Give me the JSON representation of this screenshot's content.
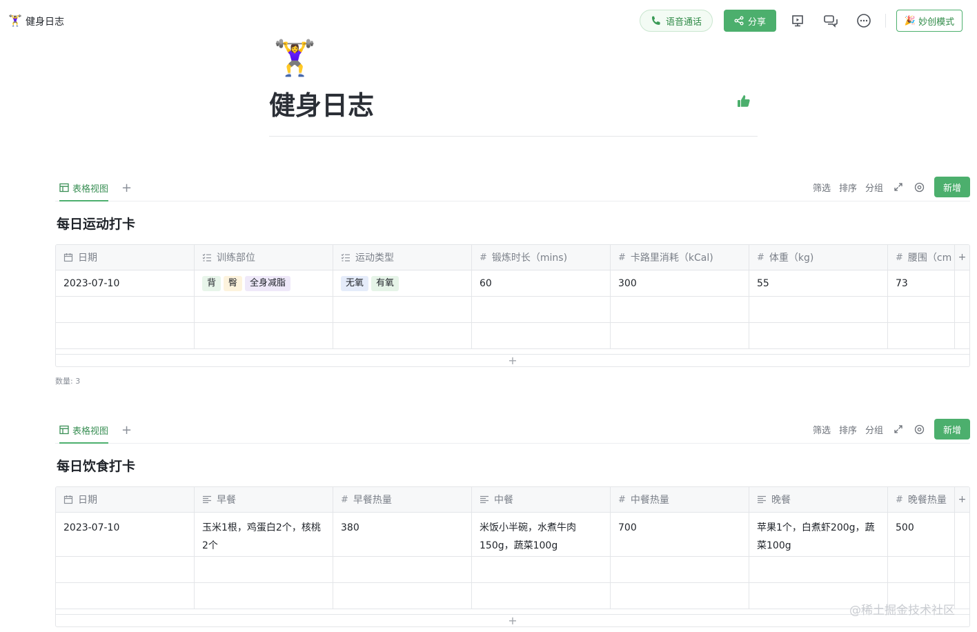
{
  "app": {
    "title": "健身日志",
    "icon": "weightlifting-emoji",
    "emoji": "🏋️‍♀️"
  },
  "toolbar": {
    "voice_call": "语音通话",
    "share": "分享",
    "magic_mode": "妙创模式",
    "icons": [
      "present-icon",
      "comment-icon",
      "more-icon"
    ]
  },
  "page": {
    "emoji": "🏋️‍♀️",
    "title": "健身日志"
  },
  "databases": [
    {
      "view_tab": "表格视图",
      "actions": {
        "filter": "筛选",
        "sort": "排序",
        "group": "分组",
        "new": "新增"
      },
      "title": "每日运动打卡",
      "columns": [
        {
          "icon": "calendar-icon",
          "label": "日期"
        },
        {
          "icon": "multi-select-icon",
          "label": "训练部位"
        },
        {
          "icon": "multi-select-icon",
          "label": "运动类型"
        },
        {
          "icon": "number-icon",
          "label": "锻炼时长（mins)"
        },
        {
          "icon": "number-icon",
          "label": "卡路里消耗（kCal)"
        },
        {
          "icon": "number-icon",
          "label": "体重（kg)"
        },
        {
          "icon": "number-icon",
          "label": "腰围（cm"
        }
      ],
      "row": {
        "date": "2023-07-10",
        "body_parts": [
          {
            "label": "背",
            "color": "#e8f5ea"
          },
          {
            "label": "臀",
            "color": "#fdf3dd"
          },
          {
            "label": "全身减脂",
            "color": "#efe9f9"
          }
        ],
        "types": [
          {
            "label": "无氧",
            "color": "#e5ecfa"
          },
          {
            "label": "有氧",
            "color": "#e6f4e8"
          }
        ],
        "duration": "60",
        "calories": "300",
        "weight": "55",
        "waist": "73"
      },
      "count_label": "数量: 3"
    },
    {
      "view_tab": "表格视图",
      "actions": {
        "filter": "筛选",
        "sort": "排序",
        "group": "分组",
        "new": "新增"
      },
      "title": "每日饮食打卡",
      "columns": [
        {
          "icon": "calendar-icon",
          "label": "日期"
        },
        {
          "icon": "text-icon",
          "label": "早餐"
        },
        {
          "icon": "number-icon",
          "label": "早餐热量"
        },
        {
          "icon": "text-icon",
          "label": "中餐"
        },
        {
          "icon": "number-icon",
          "label": "中餐热量"
        },
        {
          "icon": "text-icon",
          "label": "晚餐"
        },
        {
          "icon": "number-icon",
          "label": "晚餐热量"
        }
      ],
      "row": {
        "date": "2023-07-10",
        "breakfast": "玉米1根，鸡蛋白2个，核桃2个",
        "breakfast_kcal": "380",
        "lunch": "米饭小半碗，水煮牛肉150g，蔬菜100g",
        "lunch_kcal": "700",
        "dinner": "苹果1个，白煮虾200g，蔬菜100g",
        "dinner_kcal": "500"
      }
    }
  ],
  "watermark": "@稀土掘金技术社区",
  "accent_color": "#4caf6d"
}
